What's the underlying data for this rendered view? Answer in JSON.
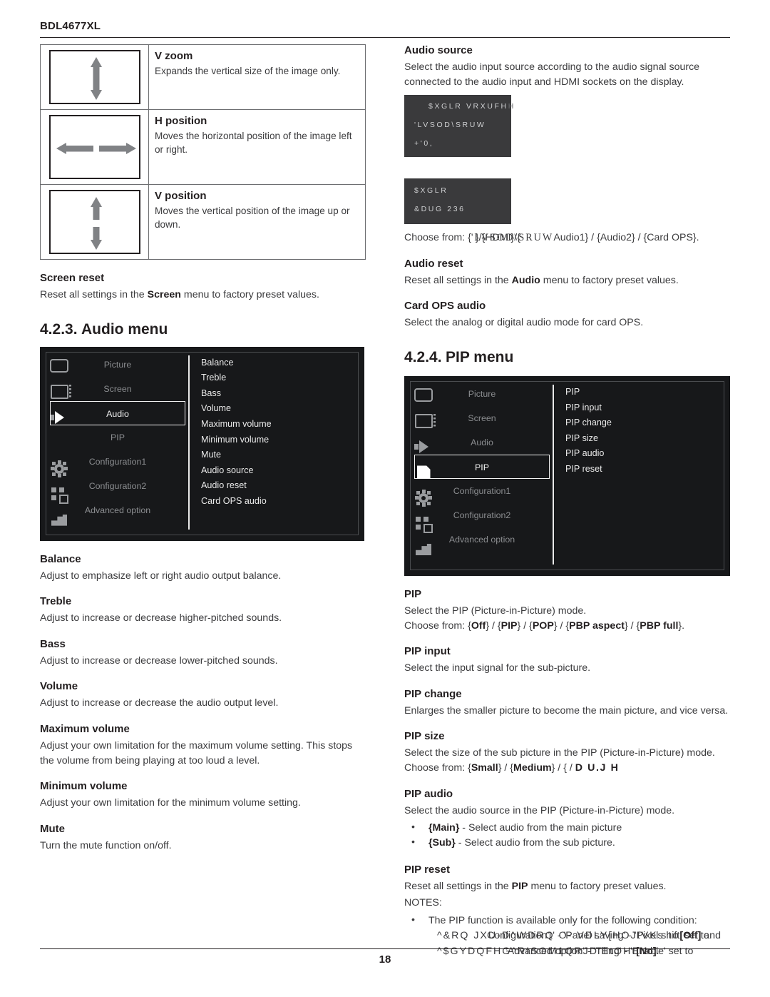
{
  "header": {
    "model": "BDL4677XL"
  },
  "footer": {
    "page_number": "18"
  },
  "screen_table": {
    "rows": [
      {
        "icon": "vertical-double-arrow",
        "title": "V zoom",
        "desc": "Expands the vertical size of the image only."
      },
      {
        "icon": "horizontal-split-arrows",
        "title": "H position",
        "desc": "Moves the horizontal position of the image left or right."
      },
      {
        "icon": "vertical-split-arrows",
        "title": "V position",
        "desc": "Moves the vertical position of the image up or down."
      }
    ]
  },
  "screen_reset": {
    "title": "Screen reset",
    "desc_before": "Reset all settings in the ",
    "desc_bold": "Screen",
    "desc_after": " menu to factory preset values."
  },
  "audio_section": {
    "number": "4.2.3.",
    "title": "Audio menu",
    "osd": {
      "left_items": [
        "Picture",
        "Screen",
        "Audio",
        "PIP",
        "Configuration1",
        "Configuration2",
        "Advanced option"
      ],
      "selected": "Audio",
      "right_items": [
        "Balance",
        "Treble",
        "Bass",
        "Volume",
        "Maximum volume",
        "Minimum volume",
        "Mute",
        "Audio source",
        "Audio reset",
        "Card OPS audio"
      ]
    },
    "terms": [
      {
        "title": "Balance",
        "desc": "Adjust to emphasize left or right audio output balance."
      },
      {
        "title": "Treble",
        "desc": "Adjust to increase or decrease higher-pitched sounds."
      },
      {
        "title": "Bass",
        "desc": "Adjust to increase or decrease lower-pitched sounds."
      },
      {
        "title": "Volume",
        "desc": "Adjust to increase or decrease the audio output level."
      },
      {
        "title": "Maximum volume",
        "desc": "Adjust your own limitation for the maximum volume setting. This stops the volume from being playing at too loud a level."
      },
      {
        "title": "Minimum volume",
        "desc": "Adjust your own limitation for the minimum volume setting."
      },
      {
        "title": "Mute",
        "desc": "Turn the mute function on/off."
      }
    ]
  },
  "audio_source": {
    "title": "Audio source",
    "desc": "Select the audio input source according to the audio signal source connected to the audio input and HDMI sockets on the display.",
    "popup": {
      "header_row": "$XGLR VRXUFH",
      "header_tail": "H",
      "rows_top": [
        "'LVSOD\\SRUW",
        "+'0,"
      ],
      "rows_bottom": [
        "$XGLR",
        "&DUG 236"
      ]
    },
    "choose_prefix": "Choose from: {",
    "choose_garbled_under": "'LVSOD\\SRUW",
    "choose_garbled_over": "}/{HDMI}/{",
    "choose_suffix": "Audio1} / {Audio2} / {Card OPS}."
  },
  "audio_reset": {
    "title": "Audio reset",
    "desc_before": "Reset all settings in the ",
    "desc_bold": "Audio",
    "desc_after": " menu to factory preset values."
  },
  "card_ops_audio": {
    "title": "Card OPS audio",
    "desc": "Select the analog or digital audio mode for card OPS."
  },
  "pip_section": {
    "number": "4.2.4.",
    "title": "PIP menu",
    "osd": {
      "left_items": [
        "Picture",
        "Screen",
        "Audio",
        "PIP",
        "Configuration1",
        "Configuration2",
        "Advanced option"
      ],
      "selected": "PIP",
      "right_items": [
        "PIP",
        "PIP input",
        "PIP change",
        "PIP size",
        "PIP audio",
        "PIP reset"
      ]
    }
  },
  "pip_terms": {
    "pip": {
      "title": "PIP",
      "desc": "Select the PIP (Picture-in-Picture) mode.",
      "choose": "Choose from: {Off} / {PIP} / {POP} / {PBP aspect} / {PBP full}.",
      "choose_parts": [
        "Choose from: {",
        "Off",
        "} / {",
        "PIP",
        "} / {",
        "POP",
        "} / {",
        "PBP aspect",
        "} / {",
        "PBP full",
        "}."
      ]
    },
    "pip_input": {
      "title": "PIP input",
      "desc": "Select the input signal for the sub-picture."
    },
    "pip_change": {
      "title": "PIP change",
      "desc": "Enlarges the smaller picture to become the main picture, and vice versa."
    },
    "pip_size": {
      "title": "PIP size",
      "desc": "Select the size of the sub picture in the PIP (Picture-in-Picture) mode.",
      "choose_prefix": "Choose from: {",
      "small": "Small",
      "sep1": "} / {",
      "medium": "Medium",
      "sep2": "} / { /",
      "garbled_large": "D U.J H"
    },
    "pip_audio": {
      "title": "PIP audio",
      "desc": "Select the audio source in the PIP (Picture-in-Picture) mode.",
      "bullets": [
        {
          "bold": "{Main}",
          "rest": " - Select audio from the main picture"
        },
        {
          "bold": "{Sub}",
          "rest": " - Select audio from the sub picture."
        }
      ]
    },
    "pip_reset": {
      "title": "PIP reset",
      "desc_before": "Reset all settings in the ",
      "desc_bold": "PIP",
      "desc_after": " menu to factory preset values.",
      "notes_label": "NOTES:",
      "note_intro": "The PIP function is available only for the following condition:",
      "note_line1_under": "^&RQ JXU-D^WDRQ O- VDLY[HOJtVKs to",
      "note_line1_over": "Configuration1' - 'Panel saving' - 'Pixel shift' set to",
      "note_line1_tail_bold": "[Off]",
      "note_line1_tail": " and",
      "note_line2_under": "^$GYDQFHG^RISOM1QRJD'EtOHt",
      "note_line2_over": "'Advanced option' - 'Tiling' - 'Enable' set to",
      "note_line2_tail_bold": "[No]",
      "note_line2_tail": "."
    }
  }
}
